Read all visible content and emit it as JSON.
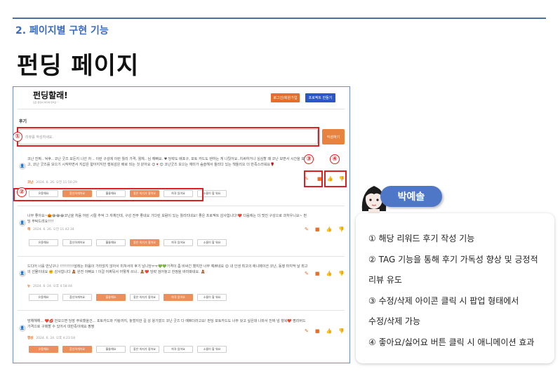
{
  "slide": {
    "section": "2. 페이지별 구현 기능",
    "heading": "펀딩 페이지"
  },
  "header": {
    "logo": "펀딩할래!",
    "logo_sub": "모든 펀딩이 여기에 있어요 ㅡ",
    "login_button": "로그인/회원가입",
    "create_button": "프로젝트 만들기"
  },
  "review_form": {
    "title": "후기",
    "placeholder": "리뷰를 작성하세요.",
    "submit_label": "작성하기"
  },
  "markers": [
    "①",
    "②",
    "③",
    "④"
  ],
  "icons": [
    "edit-pencil-icon",
    "delete-trash-icon",
    "thumbs-up-icon",
    "thumbs-down-icon"
  ],
  "tags": [
    "유용해요",
    "참신하게어요",
    "휼륭해요",
    "좋은 의지가 좋아요",
    "희귀 있어요",
    "소름이 할 워요"
  ],
  "reviews": [
    {
      "text": "코난 진짜.. 덕후.. 코난 굿즈 모든지 나선 처 .. 이런 구성에 이런 퀄리 가격, 퀄체.. 님 예뻐요. ♥ 당략도 배포구, 포토 카드도 텐하는 게 나뒀어요..치써하거나 심심할 때 코난 보면서 시간을 보냈고, 코난 굿즈를 모으기 시작하면서 지갑은 얇아지지만 행복감은 배로 되는 것 같아요 😊🍷😊 코난굿즈 모으는 재미가 숨슬해서 들리다 있는 책들리오 더 만족스러워요🌹",
      "name": "코난",
      "date": "2024. 6. 26. 오전 11:50:29",
      "active_tags": [
        1,
        3
      ]
    },
    {
      "text": "너무 좋아요~🎃😂😂😂코난을 처음 어린 시절 추억 그 자체인데, 구성 전부 좋네요 기다린 보람이 있는 퀄리티네요! 좋은 프로젝트 감사합니다!❤️ 다음에는 더 멋진 구성으로 과처우니요~ 펀딩 부탁드려요!!!!",
      "name": "해",
      "date": "2024. 6. 26. 오전 11:42:34",
      "active_tags": [
        3
      ]
    },
    {
      "text": "드디어 너를 만났구나 !!!!!!!!!!설레는 마음이 가라앉지 않아서 미쳐서야 후기 남니당ㅠㅠ💚💚가격이 좀 비싸긴 했지만 너무 예쁘네요 😊 내 인생 최고의 애니메이션 코난, 동행 마지막 날 최고의 선물이네요 🤗 감사합니다 🧸 완전 이뻐요 ! 이걸 어쩌둬서 어떻게 쓰냐.. 🧸❤️ 당략 검어놓고 한정을 바라봐네요. 🧸",
      "name": "뉴",
      "date": "2024. 6. 24. 오후 4:58:44",
      "active_tags": [
        2,
        4
      ]
    },
    {
      "text": "망해해해... ❤️💋 만모으면 당장 주워했을건... 포토카드와 키링까지, 놓쳤지만 길 성 왕기였으 코난 굿즈 다 예쁘더라고요! 펀딩 포토카드도 너무 갖고 싶은데 나와서 진짜 넘 행복❤️ 쩡리버드 가격으로 구매할 수 있어서 대만족이에요 짱짱",
      "name": "행성",
      "date": "2024. 6. 24. 오후 4:23:18",
      "active_tags": [
        0,
        1
      ]
    }
  ],
  "persona": {
    "name": "박예솔"
  },
  "notes": [
    "① 해당 리워드 후기 작성 기능",
    "② TAG 기능을 통해 후기 가독성 향상 및 긍정적",
    "리뷰 유도",
    "③ 수정/삭제 아이콘 클릭 시 팝업 형태에서",
    "수정/삭제 가능",
    "④ 좋아요/싫어요 버튼 클릭 시 애니메이션 효과"
  ]
}
